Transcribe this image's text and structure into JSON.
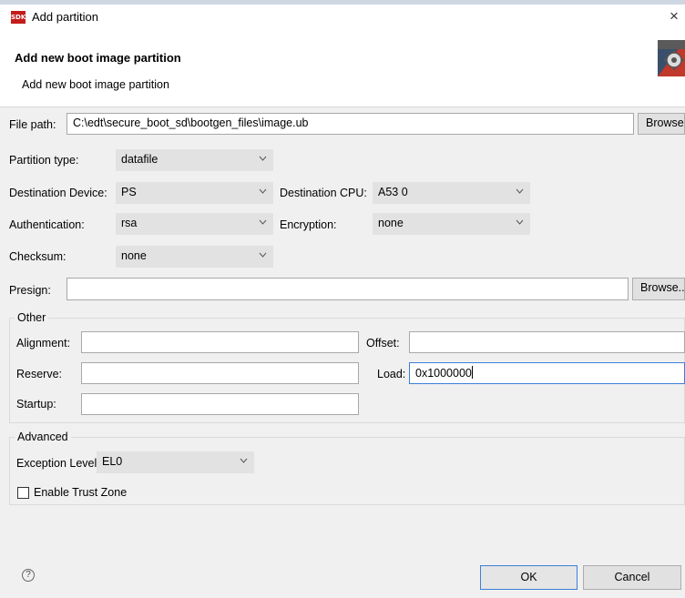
{
  "window": {
    "title": "Add partition",
    "logo_text": "SDK"
  },
  "header": {
    "title": "Add new boot image partition",
    "subtitle": "Add new boot image partition"
  },
  "form": {
    "file_path": {
      "label": "File path:",
      "value": "C:\\edt\\secure_boot_sd\\bootgen_files\\image.ub",
      "browse_label": "Browse..."
    },
    "partition_type": {
      "label": "Partition type:",
      "value": "datafile"
    },
    "destination_device": {
      "label": "Destination Device:",
      "value": "PS"
    },
    "destination_cpu": {
      "label": "Destination CPU:",
      "value": "A53 0"
    },
    "authentication": {
      "label": "Authentication:",
      "value": "rsa"
    },
    "encryption": {
      "label": "Encryption:",
      "value": "none"
    },
    "checksum": {
      "label": "Checksum:",
      "value": "none"
    },
    "presign": {
      "label": "Presign:",
      "value": "",
      "browse_label": "Browse..."
    }
  },
  "other": {
    "title": "Other",
    "alignment": {
      "label": "Alignment:",
      "value": ""
    },
    "offset": {
      "label": "Offset:",
      "value": ""
    },
    "reserve": {
      "label": "Reserve:",
      "value": ""
    },
    "load": {
      "label": "Load:",
      "value": "0x1000000"
    },
    "startup": {
      "label": "Startup:",
      "value": ""
    }
  },
  "advanced": {
    "title": "Advanced",
    "exception_level": {
      "label": "Exception Level",
      "value": "EL0"
    },
    "trust_zone": {
      "label": "Enable Trust Zone",
      "checked": false
    }
  },
  "footer": {
    "help_glyph": "?",
    "ok_label": "OK",
    "cancel_label": "Cancel"
  },
  "colors": {
    "focus_border": "#3c7fd8",
    "dialog_bg": "#f0f0f0",
    "logo_red": "#c41b1b"
  }
}
